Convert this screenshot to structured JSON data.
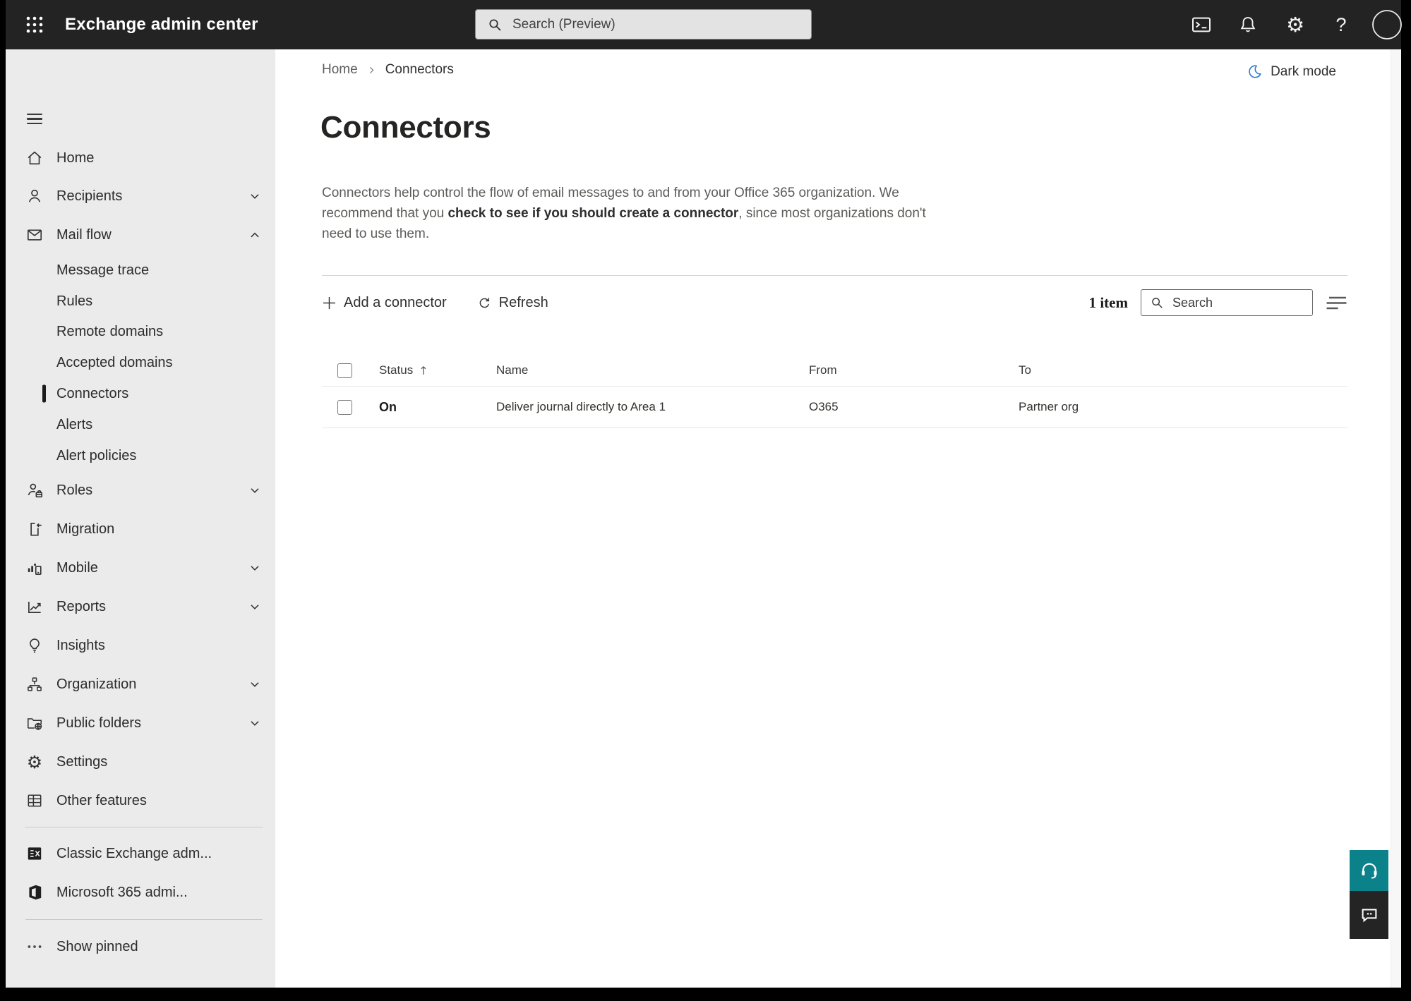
{
  "topbar": {
    "app_title": "Exchange admin center",
    "search_placeholder": "Search (Preview)"
  },
  "breadcrumb": {
    "home": "Home",
    "current": "Connectors"
  },
  "dark_mode_label": "Dark mode",
  "page": {
    "title": "Connectors",
    "description": {
      "line1": "Connectors help control the flow of email messages to and from your Office 365 organization. We",
      "line2_pre": "recommend that you ",
      "line2_link": "check to see if you should create a connector",
      "line2_post": ", since most organizations don't",
      "line3": "need to use them."
    }
  },
  "toolbar": {
    "add_label": "Add a connector",
    "refresh_label": "Refresh",
    "item_count": "1 item",
    "search_placeholder": "Search"
  },
  "table": {
    "headers": {
      "status": "Status",
      "name": "Name",
      "from": "From",
      "to": "To"
    },
    "rows": [
      {
        "status": "On",
        "name": "Deliver journal directly to Area 1",
        "from": "O365",
        "to": "Partner org"
      }
    ]
  },
  "sidebar": {
    "items": [
      {
        "label": "Home"
      },
      {
        "label": "Recipients"
      },
      {
        "label": "Mail flow"
      },
      {
        "label": "Message trace"
      },
      {
        "label": "Rules"
      },
      {
        "label": "Remote domains"
      },
      {
        "label": "Accepted domains"
      },
      {
        "label": "Connectors"
      },
      {
        "label": "Alerts"
      },
      {
        "label": "Alert policies"
      },
      {
        "label": "Roles"
      },
      {
        "label": "Migration"
      },
      {
        "label": "Mobile"
      },
      {
        "label": "Reports"
      },
      {
        "label": "Insights"
      },
      {
        "label": "Organization"
      },
      {
        "label": "Public folders"
      },
      {
        "label": "Settings"
      },
      {
        "label": "Other features"
      }
    ],
    "footer_items": [
      {
        "label": "Classic Exchange adm..."
      },
      {
        "label": "Microsoft 365 admi..."
      }
    ],
    "show_pinned_label": "Show pinned"
  },
  "colors": {
    "topbar_bg": "#232323",
    "sidebar_bg": "#ebebeb",
    "moon_blue": "#2b7cd3",
    "support_teal": "#0b828a",
    "feedback_bg": "#242424",
    "selected_indicator": "#1b1b1b"
  }
}
